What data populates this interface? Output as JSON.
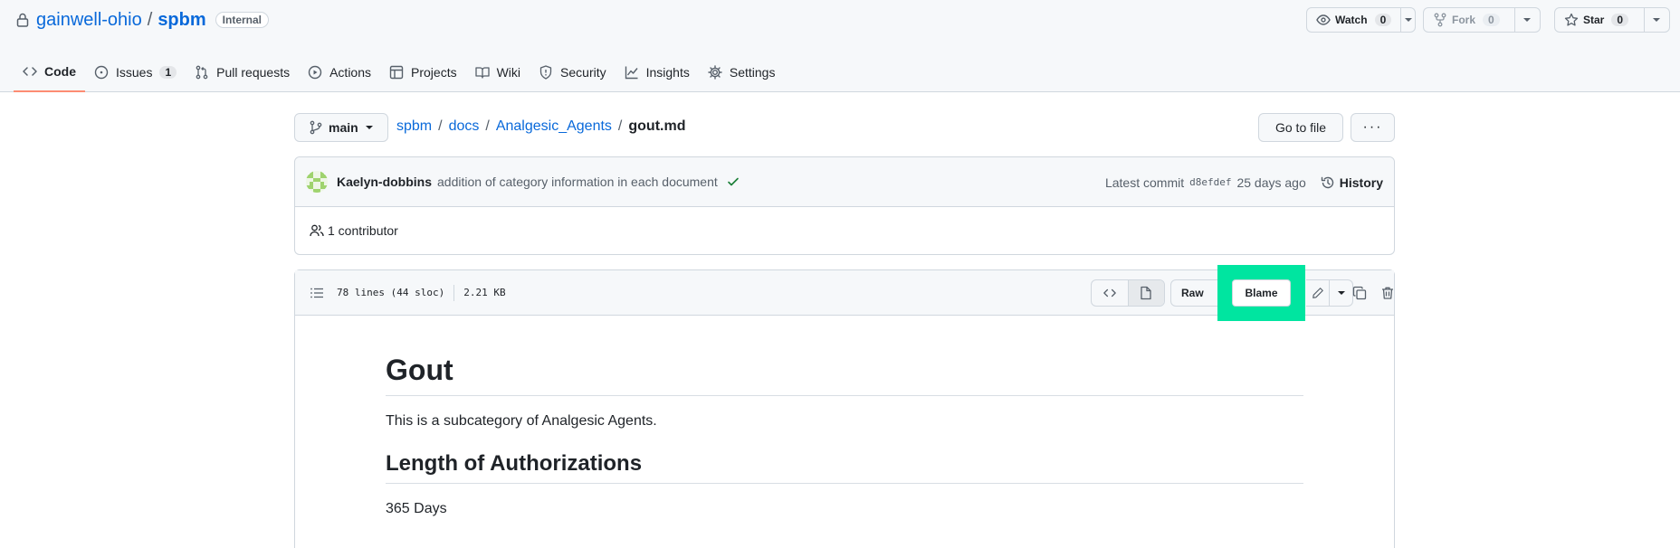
{
  "repo": {
    "owner": "gainwell-ohio",
    "separator": "/",
    "name": "spbm",
    "visibility": "Internal"
  },
  "actions": {
    "watch": {
      "label": "Watch",
      "count": "0"
    },
    "fork": {
      "label": "Fork",
      "count": "0"
    },
    "star": {
      "label": "Star",
      "count": "0"
    }
  },
  "nav": {
    "code": "Code",
    "issues": "Issues",
    "issues_count": "1",
    "pulls": "Pull requests",
    "actions": "Actions",
    "projects": "Projects",
    "wiki": "Wiki",
    "security": "Security",
    "insights": "Insights",
    "settings": "Settings"
  },
  "file_nav": {
    "branch": "main",
    "crumbs": [
      "spbm",
      "docs",
      "Analgesic_Agents"
    ],
    "separator": "/",
    "current": "gout.md",
    "go_to_file": "Go to file",
    "more": "···"
  },
  "commit": {
    "author": "Kaelyn-dobbins",
    "message": "addition of category information in each document",
    "latest_label": "Latest commit",
    "sha": "d8efdef",
    "age": "25 days ago",
    "history": "History",
    "contributors": "1 contributor"
  },
  "file": {
    "lines": "78 lines (44 sloc)",
    "size": "2.21 KB",
    "raw": "Raw",
    "blame": "Blame"
  },
  "content": {
    "h1": "Gout",
    "intro": "This is a subcategory of Analgesic Agents.",
    "h2": "Length of Authorizations",
    "duration": "365 Days"
  },
  "colors": {
    "link": "#0969da",
    "active_tab_underline": "#fd8c73",
    "highlight": "#00e5a0",
    "success": "#1a7f37"
  }
}
